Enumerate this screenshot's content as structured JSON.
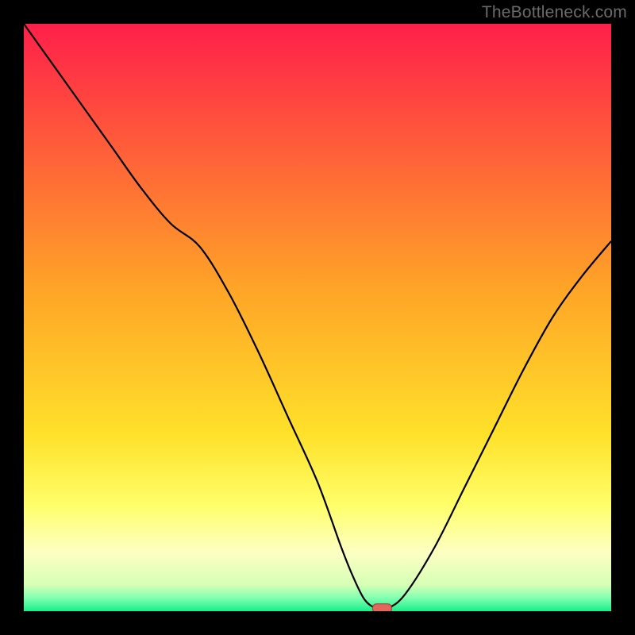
{
  "watermark": "TheBottleneck.com",
  "colors": {
    "black": "#000000",
    "curve": "#000000",
    "marker_fill": "#e3655b",
    "marker_stroke": "#a23d37",
    "gradient_stops": [
      {
        "offset": 0.0,
        "color": "#ff1f4a"
      },
      {
        "offset": 0.45,
        "color": "#ffa427"
      },
      {
        "offset": 0.7,
        "color": "#ffe12a"
      },
      {
        "offset": 0.82,
        "color": "#ffff6a"
      },
      {
        "offset": 0.9,
        "color": "#fdffc2"
      },
      {
        "offset": 0.955,
        "color": "#d7ffb5"
      },
      {
        "offset": 0.978,
        "color": "#7fffb0"
      },
      {
        "offset": 1.0,
        "color": "#18ef8a"
      }
    ]
  },
  "chart_data": {
    "type": "line",
    "title": "",
    "xlabel": "",
    "ylabel": "",
    "xlim": [
      0,
      100
    ],
    "ylim": [
      0,
      100
    ],
    "x": [
      0,
      5,
      10,
      15,
      20,
      25,
      30,
      35,
      40,
      45,
      50,
      54,
      56,
      58,
      60,
      62,
      65,
      70,
      75,
      80,
      85,
      90,
      95,
      100
    ],
    "values": [
      100,
      93,
      86,
      79,
      72,
      66,
      62,
      54,
      44,
      33,
      22,
      11,
      6,
      2,
      0.5,
      0.5,
      3,
      11,
      21,
      31,
      41,
      50,
      57,
      63
    ],
    "flat_bottom": {
      "x_start": 59,
      "x_end": 63,
      "y": 0.5
    },
    "marker": {
      "x": 61,
      "y": 0.5
    },
    "gradient_axis": "vertical"
  }
}
